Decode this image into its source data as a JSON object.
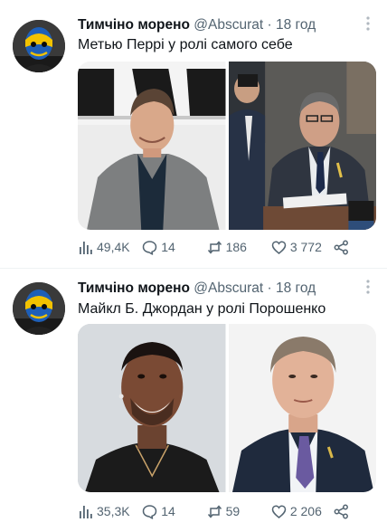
{
  "tweets": [
    {
      "display_name": "Тимчіно морено",
      "handle": "@Abscurat",
      "separator": "·",
      "time": "18 год",
      "text": "Метью Перрі у ролі самого себе",
      "stats": {
        "views": "49,4K",
        "replies": "14",
        "retweets": "186",
        "likes": "3 772"
      }
    },
    {
      "display_name": "Тимчіно морено",
      "handle": "@Abscurat",
      "separator": "·",
      "time": "18 год",
      "text": "Майкл Б. Джордан у ролі Порошенко",
      "stats": {
        "views": "35,3K",
        "replies": "14",
        "retweets": "59",
        "likes": "2 206"
      }
    }
  ],
  "icons": {
    "views": "bar-chart-icon",
    "reply": "speech-bubble-icon",
    "retweet": "retweet-arrows-icon",
    "like": "heart-icon",
    "share": "share-nodes-icon",
    "more": "vertical-dots-icon"
  },
  "colors": {
    "text": "#0f1419",
    "secondary": "#536471",
    "avatar_blue": "#1e5fb8",
    "avatar_yellow": "#f2c200"
  }
}
